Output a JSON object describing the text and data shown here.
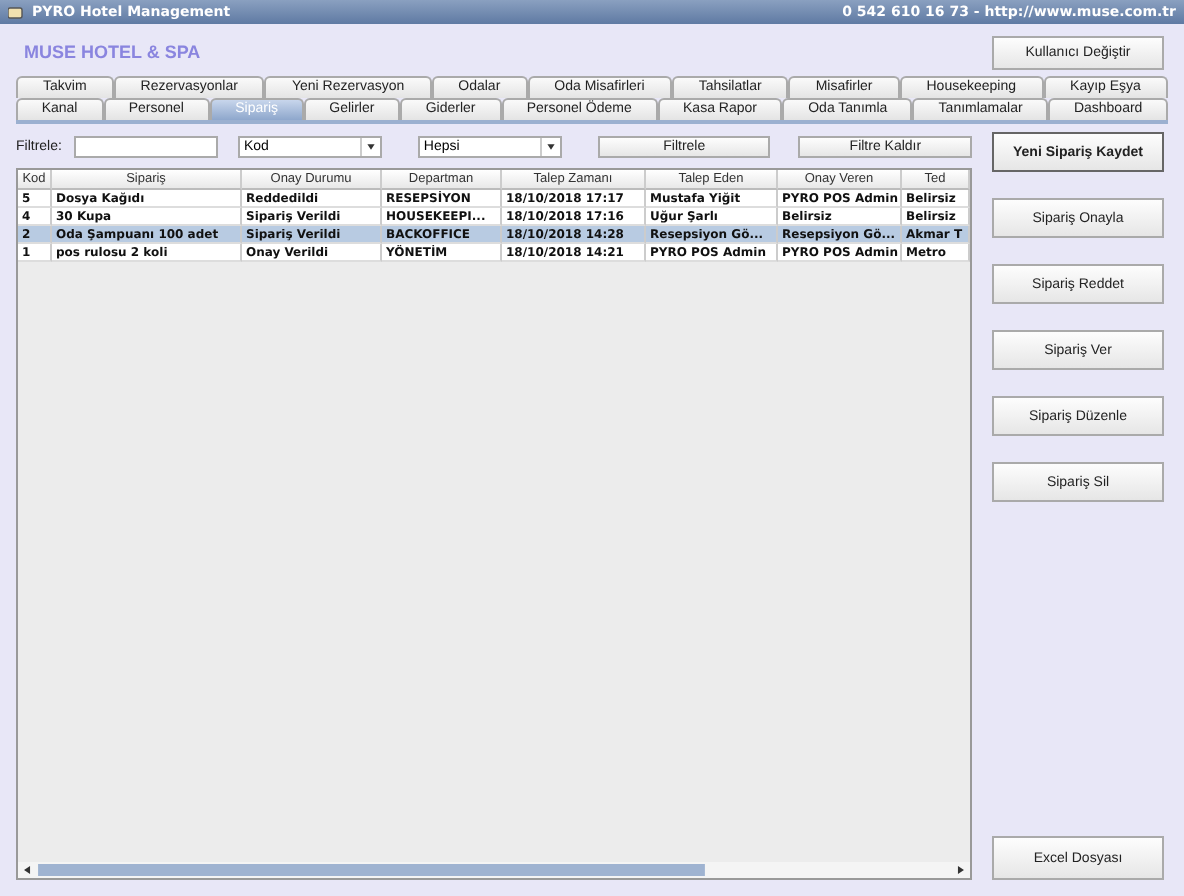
{
  "window": {
    "title": "PYRO Hotel Management",
    "contact": "0 542 610 16 73  -  http://www.muse.com.tr"
  },
  "header": {
    "brand": "MUSE HOTEL & SPA",
    "switch_user": "Kullanıcı Değiştir"
  },
  "tab_rows": [
    [
      {
        "label": "Takvim",
        "selected": false
      },
      {
        "label": "Rezervasyonlar",
        "selected": false
      },
      {
        "label": "Yeni Rezervasyon",
        "selected": false
      },
      {
        "label": "Odalar",
        "selected": false
      },
      {
        "label": "Oda Misafirleri",
        "selected": false
      },
      {
        "label": "Tahsilatlar",
        "selected": false
      },
      {
        "label": "Misafirler",
        "selected": false
      },
      {
        "label": "Housekeeping",
        "selected": false
      },
      {
        "label": "Kayıp Eşya",
        "selected": false
      }
    ],
    [
      {
        "label": "Kanal",
        "selected": false
      },
      {
        "label": "Personel",
        "selected": false
      },
      {
        "label": "Sipariş",
        "selected": true
      },
      {
        "label": "Gelirler",
        "selected": false
      },
      {
        "label": "Giderler",
        "selected": false
      },
      {
        "label": "Personel Ödeme",
        "selected": false
      },
      {
        "label": "Kasa Rapor",
        "selected": false
      },
      {
        "label": "Oda Tanımla",
        "selected": false
      },
      {
        "label": "Tanımlamalar",
        "selected": false
      },
      {
        "label": "Dashboard",
        "selected": false
      }
    ]
  ],
  "filter": {
    "label": "Filtrele:",
    "field_select": "Kod",
    "status_select": "Hepsi",
    "apply": "Filtrele",
    "clear": "Filtre Kaldır"
  },
  "table": {
    "columns": [
      "Kod",
      "Sipariş",
      "Onay Durumu",
      "Departman",
      "Talep Zamanı",
      "Talep Eden",
      "Onay Veren",
      "Ted"
    ],
    "rows": [
      {
        "cells": [
          "5",
          "Dosya Kağıdı",
          "Reddedildi",
          "RESEPSİYON",
          "18/10/2018 17:17",
          "Mustafa Yiğit",
          "PYRO POS Admin",
          "Belirsiz"
        ],
        "selected": false
      },
      {
        "cells": [
          "4",
          "30 Kupa",
          "Sipariş Verildi",
          "HOUSEKEEPI...",
          "18/10/2018 17:16",
          "Uğur Şarlı",
          "Belirsiz",
          "Belirsiz"
        ],
        "selected": false
      },
      {
        "cells": [
          "2",
          "Oda Şampuanı 100 adet",
          "Sipariş Verildi",
          "BACKOFFICE",
          "18/10/2018 14:28",
          "Resepsiyon Gö...",
          "Resepsiyon Gö...",
          "Akmar T"
        ],
        "selected": true
      },
      {
        "cells": [
          "1",
          "pos rulosu 2 koli",
          "Onay Verildi",
          "YÖNETİM",
          "18/10/2018 14:21",
          "PYRO POS Admin",
          "PYRO POS Admin",
          "Metro"
        ],
        "selected": false
      }
    ]
  },
  "actions": [
    {
      "label": "Yeni Sipariş Kaydet",
      "primary": true
    },
    {
      "label": "Sipariş Onayla",
      "primary": false
    },
    {
      "label": "Sipariş Reddet",
      "primary": false
    },
    {
      "label": "Sipariş Ver",
      "primary": false
    },
    {
      "label": "Sipariş Düzenle",
      "primary": false
    },
    {
      "label": "Sipariş Sil",
      "primary": false
    }
  ],
  "export": "Excel Dosyası"
}
